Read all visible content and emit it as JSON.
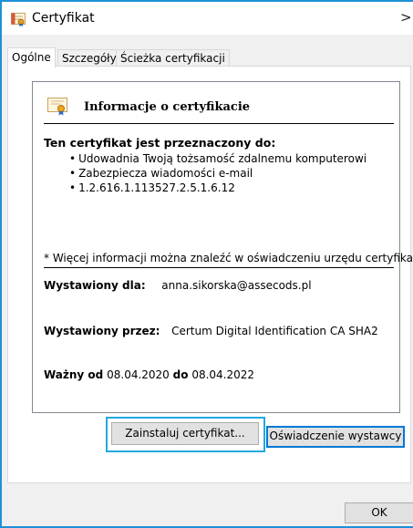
{
  "window": {
    "title": "Certyfikat",
    "close_glyph": ">"
  },
  "tabs": [
    {
      "label": "Ogólne",
      "active": true
    },
    {
      "label": "Szczegóły",
      "active": false
    },
    {
      "label": "Ścieżka certyfikacji",
      "active": false
    }
  ],
  "info": {
    "heading": "Informacje o certyfikacie",
    "purpose_heading": "Ten certyfikat jest przeznaczony do:",
    "purposes": [
      "Udowadnia Twoją tożsamość zdalnemu komputerowi",
      "Zabezpiecza wiadomości e-mail",
      "1.2.616.1.113527.2.5.1.6.12"
    ],
    "note": "* Więcej informacji można znaleźć w oświadczeniu urzędu certyfikacji.",
    "issued_to_label": "Wystawiony dla:",
    "issued_to_value": "anna.sikorska@assecods.pl",
    "issued_by_label": "Wystawiony przez:",
    "issued_by_value": "Certum Digital Identification CA SHA2",
    "valid_from_label": "Ważny od",
    "valid_from_value": "08.04.2020",
    "valid_to_label": "do",
    "valid_to_value": "08.04.2022"
  },
  "buttons": {
    "install": "Zainstaluj certyfikat...",
    "issuer_statement": "Oświadczenie wystawcy",
    "ok": "OK"
  },
  "colors": {
    "accent": "#1e90d6",
    "focus_highlight": "#22a8e0",
    "default_button_border": "#0078d7"
  }
}
